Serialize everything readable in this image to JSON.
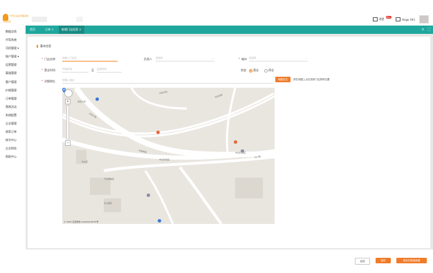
{
  "header": {
    "logo_text": "代驾云后台管理系统",
    "logo_sub": "管理后台",
    "message_label": "消息",
    "message_badge": "99+",
    "user_label": "Hugo (Hi)",
    "accent_color": "#f39a1d"
  },
  "tabs": {
    "items": [
      {
        "label": "首页"
      },
      {
        "label": "订单 ×"
      },
      {
        "label": "新增门店信息 ×"
      }
    ],
    "refresh_icon": "refresh-icon",
    "fullscreen_icon": "fullscreen-icon",
    "bar_color": "#1fa79d"
  },
  "sidebar": {
    "items": [
      {
        "label": "数据总揽"
      },
      {
        "label": "代驾系统"
      },
      {
        "label": "司机管理 ▾"
      },
      {
        "label": "账户管理 ▾"
      },
      {
        "label": "运营管理"
      },
      {
        "label": "渠道管理"
      },
      {
        "label": "客户管理"
      },
      {
        "label": "价格管理"
      },
      {
        "label": "订单管理"
      },
      {
        "label": "营销活动"
      },
      {
        "label": "系统配置"
      },
      {
        "label": "企业管理"
      },
      {
        "label": "商家订单"
      },
      {
        "label": "帐号中心"
      },
      {
        "label": "企业财务"
      },
      {
        "label": "帮助中心"
      }
    ]
  },
  "form": {
    "section_title": "基本信息",
    "store_name_label": "门店名称",
    "store_name_placeholder": "请输入门店名",
    "manager_label": "负责人",
    "manager_placeholder": "请选择",
    "city_label": "城市",
    "city_placeholder": "请选择",
    "hours_label": "营业时间",
    "hours_start_placeholder": "开始时间",
    "hours_sep": "至",
    "hours_end_placeholder": "结束时间",
    "status_label": "状态",
    "status_open": "营业",
    "status_closed": "停业",
    "address_label": "详细地址",
    "address_placeholder": "请输入地址",
    "locate_button": "地图定位",
    "locate_hint": "请在地图上点击选择门店具体位置",
    "accent_color": "#f07c2a"
  },
  "map": {
    "road_labels": [
      "丰登中路",
      "丰登北路",
      "丰登南路",
      "丰台科技园",
      "科兴路",
      "东高地路",
      "汽车博物馆",
      "丰台区"
    ],
    "poi_labels": [
      "通信大厦",
      "丰台科技园",
      "东兴国际"
    ],
    "zoom_in": "+",
    "zoom_out": "−",
    "copyright": "© 2023 高德软件 GS(2021)6375号"
  },
  "footer": {
    "back_button": "返回",
    "save_button": "保存",
    "save_continue_button": "保存并继续新增"
  }
}
